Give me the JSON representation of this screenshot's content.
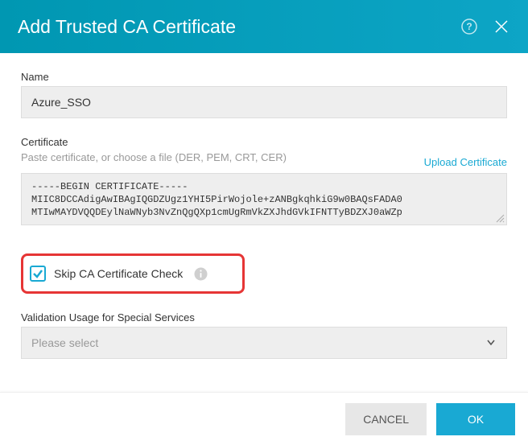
{
  "header": {
    "title": "Add Trusted CA Certificate"
  },
  "fields": {
    "name": {
      "label": "Name",
      "value": "Azure_SSO"
    },
    "certificate": {
      "label": "Certificate",
      "sublabel": "Paste certificate, or choose a file (DER, PEM, CRT, CER)",
      "upload_link": "Upload Certificate",
      "value": "-----BEGIN CERTIFICATE-----\nMIIC8DCCAdigAwIBAgIQGDZUgz1YHI5PirWojole+zANBgkqhkiG9w0BAQsFADA0\nMTIwMAYDVQQDEylNaWNyb3NvZnQgQXp1cmUgRmVkZXJhdGVkIFNTTyBDZXJ0aWZp"
    },
    "skip_check": {
      "label": "Skip CA Certificate Check",
      "checked": true
    },
    "validation_usage": {
      "label": "Validation Usage for Special Services",
      "placeholder": "Please select"
    }
  },
  "footer": {
    "cancel": "CANCEL",
    "ok": "OK"
  }
}
